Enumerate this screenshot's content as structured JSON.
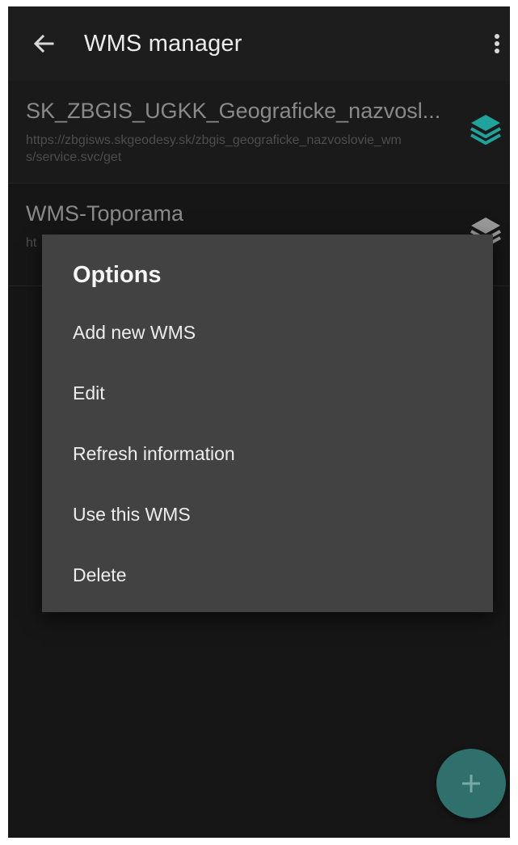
{
  "appbar": {
    "title": "WMS manager",
    "back_icon": "arrow-left-icon",
    "menu_icon": "more-vertical-icon"
  },
  "list": [
    {
      "title": "SK_ZBGIS_UGKK_Geograficke_nazvosl...",
      "url": "https://zbgisws.skgeodesy.sk/zbgis_geograficke_nazvoslovie_wms/service.svc/get",
      "icon": "layers-icon",
      "icon_color": "#1fa39a"
    },
    {
      "title": "WMS-Toporama",
      "url": "ht",
      "icon": "layers-icon",
      "icon_color": "#9a9a9a"
    }
  ],
  "dialog": {
    "title": "Options",
    "items": [
      "Add new WMS",
      "Edit",
      "Refresh information",
      "Use this WMS",
      "Delete"
    ]
  },
  "fab": {
    "icon": "plus-icon",
    "color": "#2f6f6c"
  },
  "colors": {
    "background": "#161616",
    "dialog": "#424242",
    "accent": "#1fa39a"
  }
}
